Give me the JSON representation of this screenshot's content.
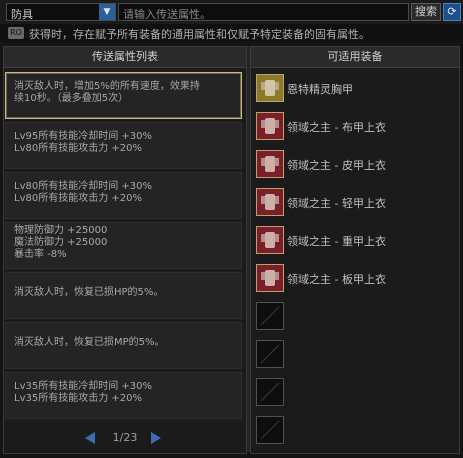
{
  "toolbar": {
    "category": "防具",
    "search_placeholder": "请输入传送属性。",
    "search_label": "搜索",
    "refresh_icon": "refresh-icon"
  },
  "notice": {
    "icon_label": "RO",
    "text": "获得时，存在赋予所有装备的通用属性和仅赋予特定装备的固有属性。"
  },
  "left_panel": {
    "title": "传送属性列表",
    "options": [
      {
        "lines": [
          "消灭敌人时，增加5%的所有速度，效果持",
          "续10秒。（最多叠加5次）"
        ],
        "selected": true
      },
      {
        "lines": [
          "Lv95所有技能冷却时间 +30%",
          "Lv80所有技能攻击力 +20%"
        ],
        "selected": false
      },
      {
        "lines": [
          "Lv80所有技能冷却时间 +30%",
          "Lv80所有技能攻击力 +20%"
        ],
        "selected": false
      },
      {
        "lines": [
          "物理防御力 +25000",
          "魔法防御力 +25000",
          "暴击率 -8%"
        ],
        "selected": false
      },
      {
        "lines": [
          "消灭敌人时，恢复已损HP的5%。"
        ],
        "selected": false
      },
      {
        "lines": [
          "消灭敌人时，恢复已损MP的5%。"
        ],
        "selected": false
      },
      {
        "lines": [
          "Lv35所有技能冷却时间 +30%",
          "Lv35所有技能攻击力 +20%"
        ],
        "selected": false
      }
    ],
    "pager": {
      "current": 1,
      "total": 23,
      "text": "1/23"
    }
  },
  "right_panel": {
    "title": "可适用装备",
    "items": [
      {
        "name": "恩特精灵胸甲",
        "color": "#8a7a2a"
      },
      {
        "name": "领域之主 - 布甲上衣",
        "color": "#7a1f2a"
      },
      {
        "name": "领域之主 - 皮甲上衣",
        "color": "#7a1f2a"
      },
      {
        "name": "领域之主 - 轻甲上衣",
        "color": "#7a1f2a"
      },
      {
        "name": "领域之主 - 重甲上衣",
        "color": "#7a1f2a"
      },
      {
        "name": "领域之主 - 板甲上衣",
        "color": "#7a1f2a"
      },
      {
        "name": ""
      },
      {
        "name": ""
      },
      {
        "name": ""
      },
      {
        "name": ""
      }
    ]
  }
}
